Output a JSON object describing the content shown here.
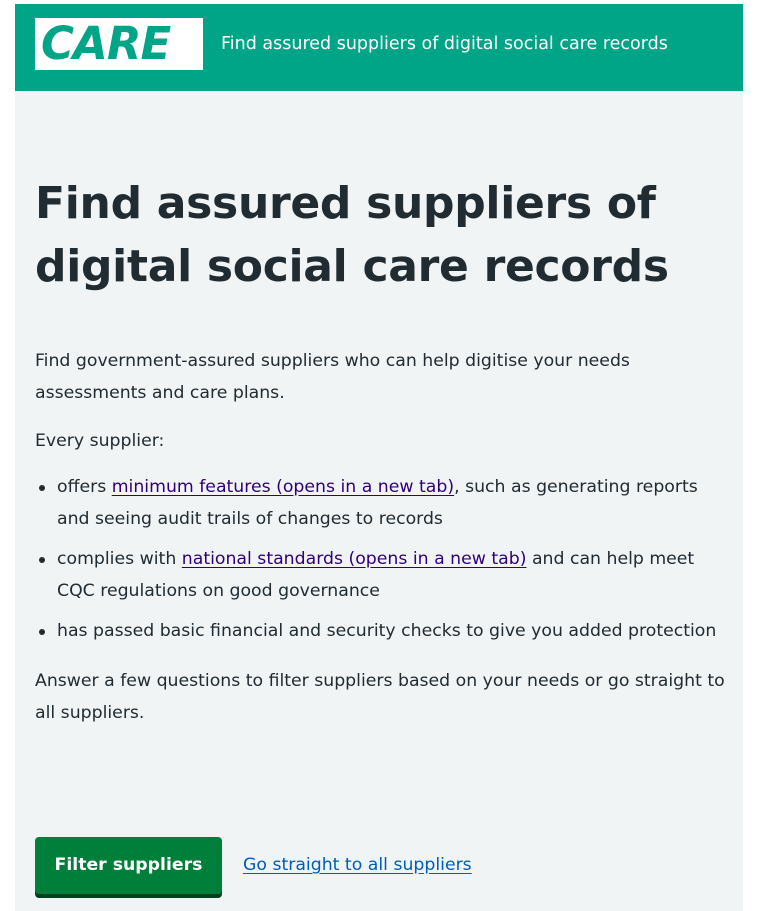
{
  "header": {
    "logo_text": "CARE",
    "service_name": "Find assured suppliers of digital social care records"
  },
  "main": {
    "heading": "Find assured suppliers of digital social care records",
    "intro": "Find government-assured suppliers who can help digitise your needs assessments and care plans.",
    "every_supplier": "Every supplier:",
    "bullets": [
      {
        "before": "offers ",
        "link": "minimum features (opens in a new tab)",
        "after": ", such as generating reports and seeing audit trails of changes to records"
      },
      {
        "before": "complies with ",
        "link": "national standards (opens in a new tab)",
        "after": " and can help meet CQC regulations on good governance"
      },
      {
        "before": "has passed basic financial and security checks to give you added protection",
        "link": "",
        "after": ""
      }
    ],
    "answer": "Answer a few questions to filter suppliers based on your needs or go straight to all suppliers."
  },
  "actions": {
    "filter_button": "Filter suppliers",
    "all_suppliers_link": "Go straight to all suppliers"
  },
  "colors": {
    "brand_green": "#00a487",
    "page_background": "#f0f4f5",
    "button_green": "#007f3b",
    "visited_link": "#330072",
    "link_blue": "#005eb8",
    "text": "#212b32"
  }
}
